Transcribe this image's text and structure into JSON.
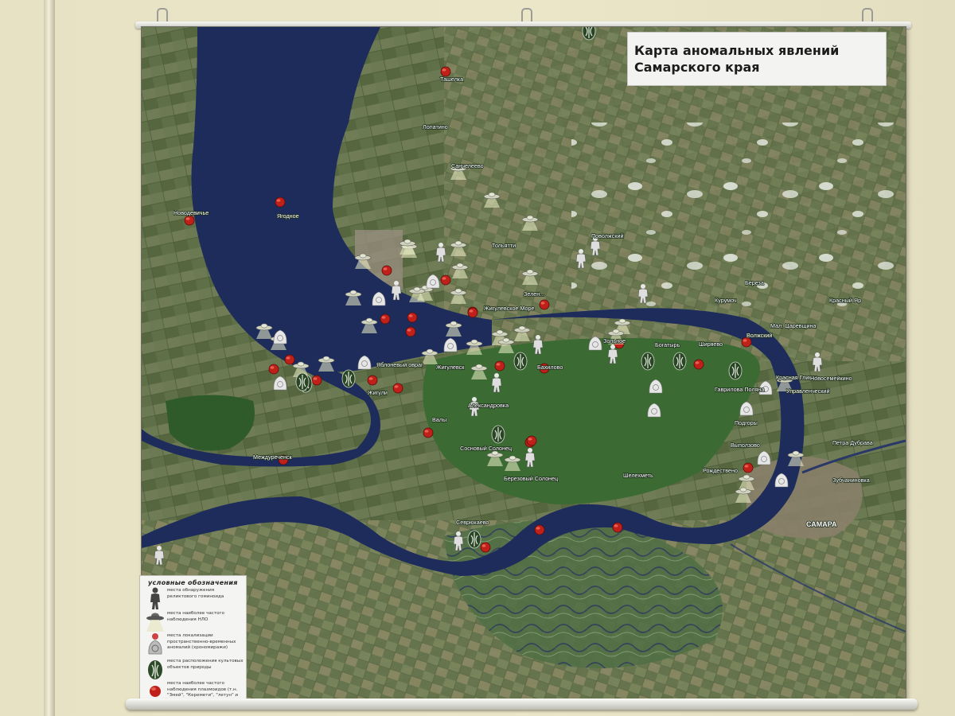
{
  "title": {
    "line1": "Карта  аномальных явлений",
    "line2": "Самарского края"
  },
  "colors": {
    "water": "#1e2c5c",
    "land_green": "#3d5a32",
    "field": "#6f7f53",
    "plasmoid_red": "#c0201a",
    "label": "#ffffff"
  },
  "legend": {
    "title": "условные обозначения",
    "items": [
      {
        "icon": "relic-hominid-icon",
        "text": "места обнаружения реликтового гоминоида"
      },
      {
        "icon": "ufo-icon",
        "text": "места наиболее частого наблюдения НЛО"
      },
      {
        "icon": "chronomirage-icon",
        "text": "места локализации пространственно-временных аномалий (хрономиражи)"
      },
      {
        "icon": "cult-object-icon",
        "text": "места расположения культовых объектов природы"
      },
      {
        "icon": "plasmoid-icon",
        "text": "места наиболее частого наблюдения плазмоидов (т.н. \"Змей\", \"Керемети\", \"летун\" и др.)"
      }
    ]
  },
  "places": [
    {
      "name": "Ташелка"
    },
    {
      "name": "Лопатино"
    },
    {
      "name": "Санчелеево"
    },
    {
      "name": "Новодевичье"
    },
    {
      "name": "Ягодное"
    },
    {
      "name": "Тольятти"
    },
    {
      "name": "Поволжский"
    },
    {
      "name": "Зелен..."
    },
    {
      "name": "Жигулевское Море"
    },
    {
      "name": "Береза"
    },
    {
      "name": "Курумоч"
    },
    {
      "name": "Красный Яр"
    },
    {
      "name": "Мал. Царевщина"
    },
    {
      "name": "Волжский"
    },
    {
      "name": "Зольное"
    },
    {
      "name": "Богатырь"
    },
    {
      "name": "Ширяево"
    },
    {
      "name": "Бахилово"
    },
    {
      "name": "Яблоневый овраг"
    },
    {
      "name": "Жигулевск"
    },
    {
      "name": "Жигули"
    },
    {
      "name": "Александровка"
    },
    {
      "name": "Валы"
    },
    {
      "name": "Красная Глинка"
    },
    {
      "name": "Новосемейкино"
    },
    {
      "name": "Управленческий"
    },
    {
      "name": "Гаврилова Поляна"
    },
    {
      "name": "Подгоры"
    },
    {
      "name": "Выползово"
    },
    {
      "name": "Петра Дубрава"
    },
    {
      "name": "Междуреченск"
    },
    {
      "name": "Сосновый Солонец"
    },
    {
      "name": "Березовый Солонец"
    },
    {
      "name": "Шелехметь"
    },
    {
      "name": "Рождествено"
    },
    {
      "name": "Зубчаниновка"
    },
    {
      "name": "Севрюкаево"
    },
    {
      "name": "САМАРА"
    }
  ]
}
